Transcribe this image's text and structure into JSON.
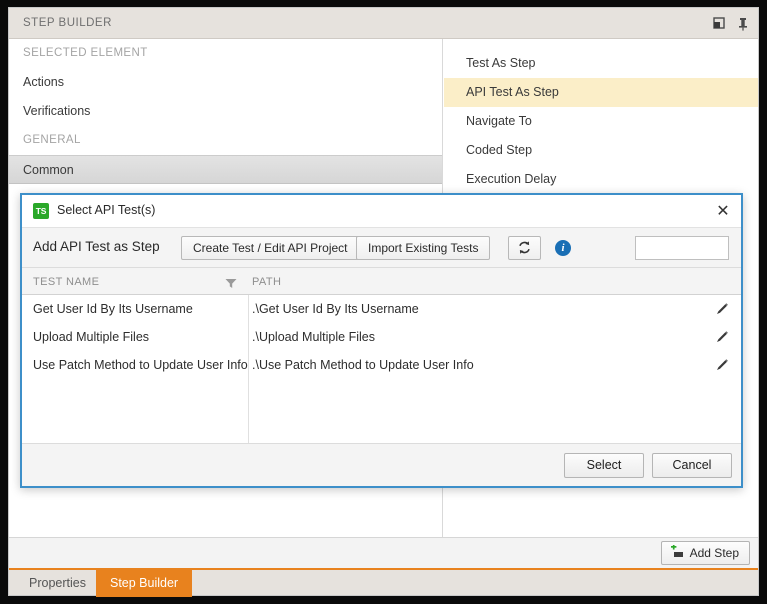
{
  "panel": {
    "title": "STEP BUILDER",
    "float_icon": "restore-window-icon",
    "pin_icon": "pin-icon"
  },
  "sidebar": {
    "groups": [
      {
        "header": "SELECTED ELEMENT",
        "items": [
          {
            "label": "Actions",
            "selected": false
          },
          {
            "label": "Verifications",
            "selected": false
          }
        ]
      },
      {
        "header": "GENERAL",
        "items": [
          {
            "label": "Common",
            "selected": true
          }
        ]
      }
    ]
  },
  "commands": {
    "items": [
      {
        "label": "Test As Step",
        "highlighted": false
      },
      {
        "label": "API Test As Step",
        "highlighted": true
      },
      {
        "label": "Navigate To",
        "highlighted": false
      },
      {
        "label": "Coded Step",
        "highlighted": false
      },
      {
        "label": "Execution Delay",
        "highlighted": false
      }
    ]
  },
  "footer": {
    "add_step_label": "Add Step",
    "add_step_icon": "add-step-icon"
  },
  "tabs": [
    {
      "label": "Properties",
      "active": false
    },
    {
      "label": "Step Builder",
      "active": true
    }
  ],
  "dialog": {
    "icon_text": "TS",
    "icon_name": "telerik-test-studio-icon",
    "title": "Select API Test(s)",
    "close_label": "✕",
    "toolbar": {
      "label": "Add API Test as Step",
      "create_test_label": "Create Test / Edit API Project",
      "import_tests_label": "Import Existing Tests",
      "refresh_icon": "refresh-icon",
      "info_icon": "info-icon",
      "info_glyph": "i",
      "search_value": "",
      "search_placeholder": ""
    },
    "grid": {
      "columns": [
        "TEST NAME",
        "PATH"
      ],
      "filter_icon": "filter-icon",
      "row_edit_icon": "edit-pencil-icon",
      "rows": [
        {
          "test_name": "Get User Id By Its Username",
          "path": ".\\Get User Id By Its Username"
        },
        {
          "test_name": "Upload Multiple Files",
          "path": ".\\Upload Multiple Files"
        },
        {
          "test_name": "Use Patch Method to Update User Info",
          "path": ".\\Use Patch Method to Update User Info"
        }
      ]
    },
    "buttons": {
      "select_label": "Select",
      "cancel_label": "Cancel"
    }
  },
  "colors": {
    "accent_orange": "#e8821e",
    "dialog_border_blue": "#3d8fc9",
    "highlight_yellow": "#fbeec8",
    "icon_green": "#2aa829",
    "info_blue": "#1a6fb5"
  }
}
